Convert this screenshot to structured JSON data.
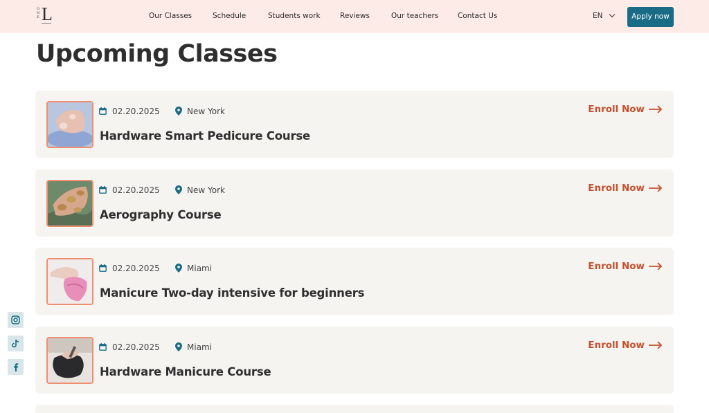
{
  "header": {
    "logo": {
      "letters": [
        "O",
        "N",
        "E"
      ],
      "big": "L"
    },
    "nav": [
      "Our Classes",
      "Schedule",
      "Students work",
      "Reviews",
      "Our teachers",
      "Contact Us"
    ],
    "language": "EN",
    "apply_label": "Apply now"
  },
  "page_title": "Upcoming Classes",
  "classes": [
    {
      "date": "02.20.2025",
      "city": "New York",
      "title": "Hardware Smart Pedicure Course",
      "enroll": "Enroll Now"
    },
    {
      "date": "02.20.2025",
      "city": "New York",
      "title": "Aerography Course",
      "enroll": "Enroll Now"
    },
    {
      "date": "02.20.2025",
      "city": "Miami",
      "title": "Manicure Two-day intensive for beginners",
      "enroll": "Enroll Now"
    },
    {
      "date": "02.20.2025",
      "city": "Miami",
      "title": "Hardware Manicure Course",
      "enroll": "Enroll Now"
    }
  ],
  "social": [
    "instagram-icon",
    "tiktok-icon",
    "facebook-icon"
  ],
  "colors": {
    "header_bg": "#fdebe8",
    "accent": "#1a6c86",
    "enroll": "#c4512f",
    "thumb_border": "#ee8f72",
    "card_bg": "#f6f4f1"
  }
}
